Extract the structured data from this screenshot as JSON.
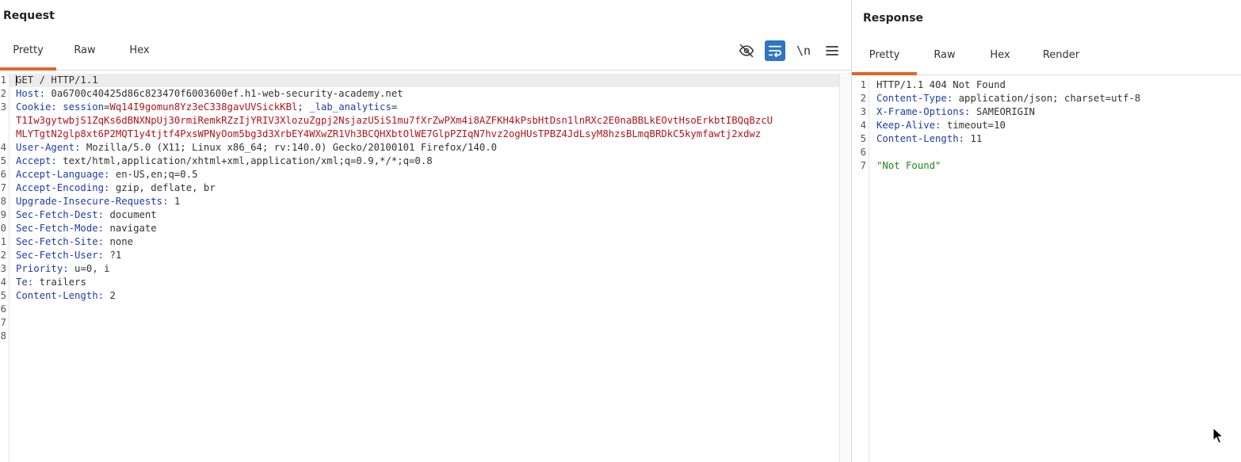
{
  "request": {
    "title": "Request",
    "tabs": [
      {
        "label": "Pretty",
        "active": true
      },
      {
        "label": "Raw",
        "active": false
      },
      {
        "label": "Hex",
        "active": false
      }
    ],
    "toolbar": {
      "newline_label": "\\n"
    },
    "lines": [
      {
        "n": "1",
        "parts": [
          {
            "t": "GET / HTTP/1.1",
            "c": "v"
          }
        ]
      },
      {
        "n": "2",
        "parts": [
          {
            "t": "Host: ",
            "c": "k"
          },
          {
            "t": "0a6700c40425d86c823470f6003600ef.h1-web-security-academy.net",
            "c": "v"
          }
        ]
      },
      {
        "n": "3",
        "parts": [
          {
            "t": "Cookie: ",
            "c": "k"
          },
          {
            "t": "session",
            "c": "k"
          },
          {
            "t": "=",
            "c": "v"
          },
          {
            "t": "Wq14I9gomun8Yz3eC338gavUVSickKBl",
            "c": "red"
          },
          {
            "t": "; ",
            "c": "v"
          },
          {
            "t": "_lab_analytics",
            "c": "k"
          },
          {
            "t": "=",
            "c": "v"
          }
        ]
      },
      {
        "n": "",
        "parts": [
          {
            "t": "T1Iw3gytwbjS1ZqKs6dBNXNpUj30rmiRemkRZzIjYRIV3XlozuZgpj2NsjazU5iS1mu7fXrZwPXm4i8AZFKH4kPsbHtDsn1lnRXc2E0naBBLkEOvtHsoErkbtIBQqBzcU",
            "c": "red"
          }
        ]
      },
      {
        "n": "",
        "parts": [
          {
            "t": "MLYTgtN2glp8xt6P2MQT1y4tjtf4PxsWPNyOom5bg3d3XrbEY4WXwZR1Vh3BCQHXbtOlWE7GlpPZIqN7hvz2ogHUsTPBZ4JdLsyM8hzsBLmqBRDkC5kymfawtj2xdwz",
            "c": "red"
          }
        ]
      },
      {
        "n": "4",
        "parts": [
          {
            "t": "User-Agent: ",
            "c": "k"
          },
          {
            "t": "Mozilla/5.0 (X11; Linux x86_64; rv:140.0) Gecko/20100101 Firefox/140.0",
            "c": "v"
          }
        ]
      },
      {
        "n": "5",
        "parts": [
          {
            "t": "Accept: ",
            "c": "k"
          },
          {
            "t": "text/html,application/xhtml+xml,application/xml;q=0.9,*/*;q=0.8",
            "c": "v"
          }
        ]
      },
      {
        "n": "6",
        "parts": [
          {
            "t": "Accept-Language: ",
            "c": "k"
          },
          {
            "t": "en-US,en;q=0.5",
            "c": "v"
          }
        ]
      },
      {
        "n": "7",
        "parts": [
          {
            "t": "Accept-Encoding: ",
            "c": "k"
          },
          {
            "t": "gzip, deflate, br",
            "c": "v"
          }
        ]
      },
      {
        "n": "8",
        "parts": [
          {
            "t": "Upgrade-Insecure-Requests: ",
            "c": "k"
          },
          {
            "t": "1",
            "c": "v"
          }
        ]
      },
      {
        "n": "9",
        "parts": [
          {
            "t": "Sec-Fetch-Dest: ",
            "c": "k"
          },
          {
            "t": "document",
            "c": "v"
          }
        ]
      },
      {
        "n": "0",
        "parts": [
          {
            "t": "Sec-Fetch-Mode: ",
            "c": "k"
          },
          {
            "t": "navigate",
            "c": "v"
          }
        ]
      },
      {
        "n": "1",
        "parts": [
          {
            "t": "Sec-Fetch-Site: ",
            "c": "k"
          },
          {
            "t": "none",
            "c": "v"
          }
        ]
      },
      {
        "n": "2",
        "parts": [
          {
            "t": "Sec-Fetch-User: ",
            "c": "k"
          },
          {
            "t": "?1",
            "c": "v"
          }
        ]
      },
      {
        "n": "3",
        "parts": [
          {
            "t": "Priority: ",
            "c": "k"
          },
          {
            "t": "u=0, i",
            "c": "v"
          }
        ]
      },
      {
        "n": "4",
        "parts": [
          {
            "t": "Te: ",
            "c": "k"
          },
          {
            "t": "trailers",
            "c": "v"
          }
        ]
      },
      {
        "n": "5",
        "parts": [
          {
            "t": "Content-Length: ",
            "c": "k"
          },
          {
            "t": "2",
            "c": "v"
          }
        ]
      },
      {
        "n": "6",
        "parts": []
      },
      {
        "n": "7",
        "parts": []
      },
      {
        "n": "8",
        "parts": []
      }
    ]
  },
  "response": {
    "title": "Response",
    "tabs": [
      {
        "label": "Pretty",
        "active": true
      },
      {
        "label": "Raw",
        "active": false
      },
      {
        "label": "Hex",
        "active": false
      },
      {
        "label": "Render",
        "active": false
      }
    ],
    "lines": [
      {
        "n": "1",
        "parts": [
          {
            "t": "HTTP/1.1 404 Not Found",
            "c": "v"
          }
        ]
      },
      {
        "n": "2",
        "parts": [
          {
            "t": "Content-Type: ",
            "c": "k"
          },
          {
            "t": "application/json; charset=utf-8",
            "c": "v"
          }
        ]
      },
      {
        "n": "3",
        "parts": [
          {
            "t": "X-Frame-Options: ",
            "c": "k"
          },
          {
            "t": "SAMEORIGIN",
            "c": "v"
          }
        ]
      },
      {
        "n": "4",
        "parts": [
          {
            "t": "Keep-Alive: ",
            "c": "k"
          },
          {
            "t": "timeout=10",
            "c": "v"
          }
        ]
      },
      {
        "n": "5",
        "parts": [
          {
            "t": "Content-Length: ",
            "c": "k"
          },
          {
            "t": "11",
            "c": "v"
          }
        ]
      },
      {
        "n": "6",
        "parts": []
      },
      {
        "n": "7",
        "parts": [
          {
            "t": "\"Not Found\"",
            "c": "str"
          }
        ]
      }
    ]
  },
  "colors": {
    "accent_tab": "#e3642c",
    "toggle_on": "#2e76c1",
    "header_key": "#1c3fa8",
    "cookie_value": "#b3141c",
    "json_string": "#1a8a1a"
  },
  "icons": [
    "eye-slash-icon",
    "wrap-lines-icon",
    "newline-toggle",
    "hamburger-menu-icon",
    "mouse-pointer-icon"
  ]
}
